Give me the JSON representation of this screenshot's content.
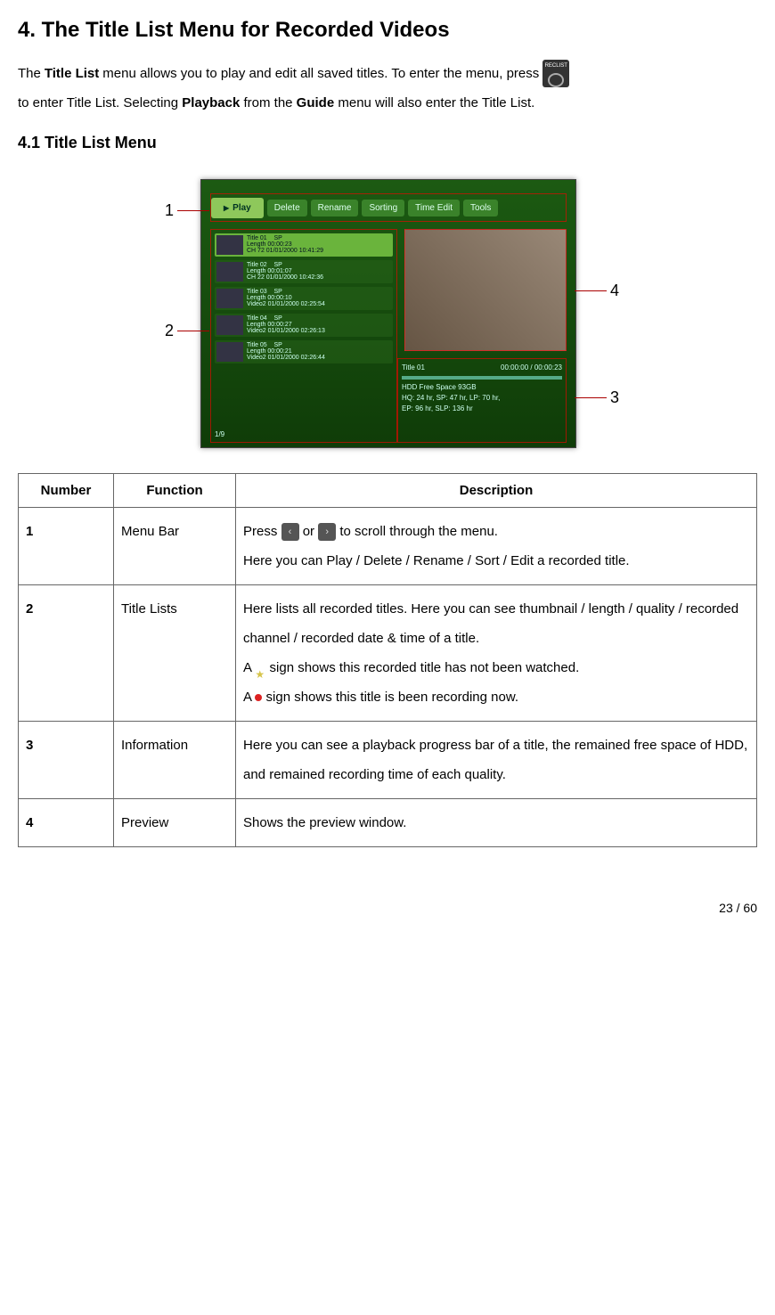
{
  "heading": "4. The Title List Menu for Recorded Videos",
  "intro": {
    "part1a": "The ",
    "bold1": "Title List",
    "part1b": " menu allows you to play and edit all saved titles. To enter the menu, press ",
    "reclist_label": "RECLIST",
    "part2a": "to enter Title List. Selecting ",
    "bold2": "Playback",
    "part2b": " from the ",
    "bold3": "Guide",
    "part2c": " menu will also enter the Title List."
  },
  "subheading": "4.1 Title List Menu",
  "screenshot": {
    "menubar": {
      "items": [
        "Play",
        "Delete",
        "Rename",
        "Sorting",
        "Time Edit",
        "Tools"
      ],
      "active": "Play"
    },
    "list": [
      {
        "title": "Title 01",
        "q": "SP",
        "len": "Length  00:00:23",
        "info": "CH 72 01/01/2000 10:41:29"
      },
      {
        "title": "Title 02",
        "q": "SP",
        "len": "Length  00:01:07",
        "info": "CH 22 01/01/2000 10:42:36"
      },
      {
        "title": "Title 03",
        "q": "SP",
        "len": "Length  00:00:10",
        "info": "Video2 01/01/2000 02:25:54"
      },
      {
        "title": "Title 04",
        "q": "SP",
        "len": "Length  00:00:27",
        "info": "Video2 01/01/2000 02:26:13"
      },
      {
        "title": "Title 05",
        "q": "SP",
        "len": "Length  00:00:21",
        "info": "Video2 01/01/2000 02:26:44"
      }
    ],
    "list_page": "1/9",
    "info": {
      "title": "Title  01",
      "time": "00:00:00 / 00:00:23",
      "space": "HDD Free Space  93GB",
      "quality": "HQ: 24 hr,     SP: 47 hr,     LP: 70 hr,",
      "quality2": "EP: 96 hr,     SLP: 136 hr"
    },
    "callouts": {
      "c1": "1",
      "c2": "2",
      "c3": "3",
      "c4": "4"
    }
  },
  "table": {
    "headers": [
      "Number",
      "Function",
      "Description"
    ],
    "rows": [
      {
        "num": "1",
        "func": "Menu Bar",
        "desc": {
          "press": "Press ",
          "or": " or ",
          "scroll": " to scroll through the menu.",
          "line2": "Here you can Play / Delete / Rename / Sort / Edit a recorded title."
        }
      },
      {
        "num": "2",
        "func": "Title Lists",
        "desc": {
          "line1": "Here lists all recorded titles. Here you can see thumbnail / length / quality / recorded channel / recorded date & time of a title.",
          "star_prefix": "A ",
          "star_suffix": " sign shows this recorded title has not been watched.",
          "dot_prefix": "A ",
          "dot_suffix": " sign shows this title is been recording now."
        }
      },
      {
        "num": "3",
        "func": "Information",
        "desc": {
          "line1": "Here you can see a playback progress bar of a title, the remained free space of HDD, and remained recording time of each quality."
        }
      },
      {
        "num": "4",
        "func": "Preview",
        "desc": {
          "line1": "Shows the preview window."
        }
      }
    ]
  },
  "page_number": "23 / 60"
}
